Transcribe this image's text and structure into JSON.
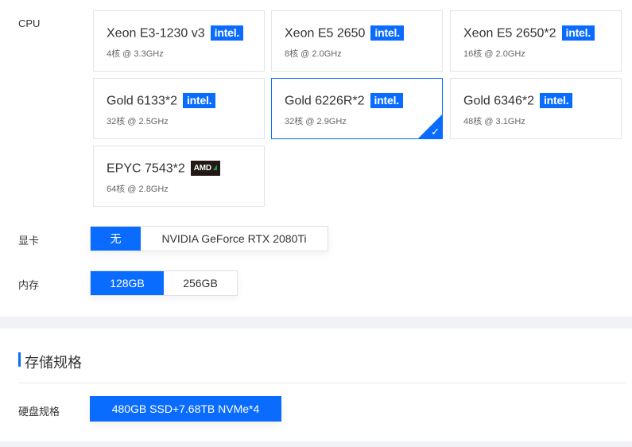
{
  "cpu": {
    "label": "CPU",
    "options": [
      {
        "name": "Xeon E3-1230 v3",
        "spec": "4核 @ 3.3GHz",
        "brand": "intel",
        "selected": false
      },
      {
        "name": "Xeon E5 2650",
        "spec": "8核 @ 2.0GHz",
        "brand": "intel",
        "selected": false
      },
      {
        "name": "Xeon E5 2650*2",
        "spec": "16核 @ 2.0GHz",
        "brand": "intel",
        "selected": false
      },
      {
        "name": "Gold 6133*2",
        "spec": "32核 @ 2.5GHz",
        "brand": "intel",
        "selected": false
      },
      {
        "name": "Gold 6226R*2",
        "spec": "32核 @ 2.9GHz",
        "brand": "intel",
        "selected": true
      },
      {
        "name": "Gold 6346*2",
        "spec": "48核 @ 3.1GHz",
        "brand": "intel",
        "selected": false
      },
      {
        "name": "EPYC 7543*2",
        "spec": "64核 @ 2.8GHz",
        "brand": "AMD",
        "selected": false
      }
    ],
    "brand_labels": {
      "intel": "intel.",
      "amd": "AMD"
    }
  },
  "gpu": {
    "label": "显卡",
    "options": [
      {
        "label": "无",
        "active": true
      },
      {
        "label": "NVIDIA GeForce RTX 2080Ti",
        "active": false
      }
    ]
  },
  "memory": {
    "label": "内存",
    "options": [
      {
        "label": "128GB",
        "active": true
      },
      {
        "label": "256GB",
        "active": false
      }
    ]
  },
  "storage": {
    "section_title": "存储规格",
    "label": "硬盘规格",
    "option": "480GB SSD+7.68TB NVMe*4"
  },
  "colors": {
    "accent": "#0a6cff",
    "band": "#f0f2f5",
    "amd_bg": "#231815"
  }
}
